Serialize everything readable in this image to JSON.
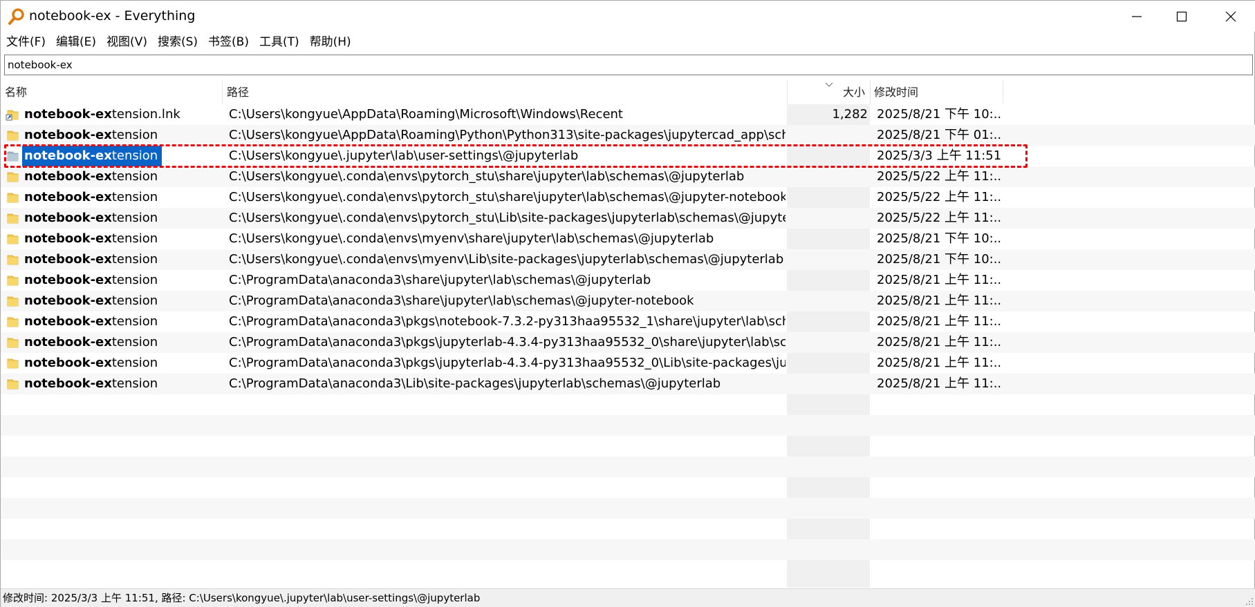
{
  "window": {
    "title": "notebook-ex - Everything",
    "minimize_icon": "minimize-icon",
    "maximize_icon": "maximize-icon",
    "close_icon": "close-icon"
  },
  "menu": [
    "文件(F)",
    "编辑(E)",
    "视图(V)",
    "搜索(S)",
    "书签(B)",
    "工具(T)",
    "帮助(H)"
  ],
  "search": {
    "value": "notebook-ex"
  },
  "columns": {
    "name": "名称",
    "path": "路径",
    "size": "大小",
    "modified": "修改时间"
  },
  "rows": [
    {
      "match": "notebook-ex",
      "rest": "tension.lnk",
      "path": "C:\\Users\\kongyue\\AppData\\Roaming\\Microsoft\\Windows\\Recent",
      "size": "1,282",
      "modified": "2025/8/21 下午 10:...",
      "icon": "shortcut-icon"
    },
    {
      "match": "notebook-ex",
      "rest": "tension",
      "path": "C:\\Users\\kongyue\\AppData\\Roaming\\Python\\Python313\\site-packages\\jupytercad_app\\sch...",
      "size": "",
      "modified": "2025/8/21 下午 01:...",
      "icon": "folder-icon"
    },
    {
      "match": "notebook-ex",
      "rest": "tension",
      "path": "C:\\Users\\kongyue\\.jupyter\\lab\\user-settings\\@jupyterlab",
      "size": "",
      "modified": "2025/3/3 上午 11:51",
      "icon": "folder-icon",
      "selected": true
    },
    {
      "match": "notebook-ex",
      "rest": "tension",
      "path": "C:\\Users\\kongyue\\.conda\\envs\\pytorch_stu\\share\\jupyter\\lab\\schemas\\@jupyterlab",
      "size": "",
      "modified": "2025/5/22 上午 11:...",
      "icon": "folder-icon"
    },
    {
      "match": "notebook-ex",
      "rest": "tension",
      "path": "C:\\Users\\kongyue\\.conda\\envs\\pytorch_stu\\share\\jupyter\\lab\\schemas\\@jupyter-notebook",
      "size": "",
      "modified": "2025/5/22 上午 11:...",
      "icon": "folder-icon"
    },
    {
      "match": "notebook-ex",
      "rest": "tension",
      "path": "C:\\Users\\kongyue\\.conda\\envs\\pytorch_stu\\Lib\\site-packages\\jupyterlab\\schemas\\@jupyter...",
      "size": "",
      "modified": "2025/5/22 上午 11:...",
      "icon": "folder-icon"
    },
    {
      "match": "notebook-ex",
      "rest": "tension",
      "path": "C:\\Users\\kongyue\\.conda\\envs\\myenv\\share\\jupyter\\lab\\schemas\\@jupyterlab",
      "size": "",
      "modified": "2025/8/21 下午 10:...",
      "icon": "folder-icon"
    },
    {
      "match": "notebook-ex",
      "rest": "tension",
      "path": "C:\\Users\\kongyue\\.conda\\envs\\myenv\\Lib\\site-packages\\jupyterlab\\schemas\\@jupyterlab",
      "size": "",
      "modified": "2025/8/21 下午 10:...",
      "icon": "folder-icon"
    },
    {
      "match": "notebook-ex",
      "rest": "tension",
      "path": "C:\\ProgramData\\anaconda3\\share\\jupyter\\lab\\schemas\\@jupyterlab",
      "size": "",
      "modified": "2025/8/21 上午 11:...",
      "icon": "folder-icon"
    },
    {
      "match": "notebook-ex",
      "rest": "tension",
      "path": "C:\\ProgramData\\anaconda3\\share\\jupyter\\lab\\schemas\\@jupyter-notebook",
      "size": "",
      "modified": "2025/8/21 上午 11:...",
      "icon": "folder-icon"
    },
    {
      "match": "notebook-ex",
      "rest": "tension",
      "path": "C:\\ProgramData\\anaconda3\\pkgs\\notebook-7.3.2-py313haa95532_1\\share\\jupyter\\lab\\sch...",
      "size": "",
      "modified": "2025/8/21 上午 11:...",
      "icon": "folder-icon"
    },
    {
      "match": "notebook-ex",
      "rest": "tension",
      "path": "C:\\ProgramData\\anaconda3\\pkgs\\jupyterlab-4.3.4-py313haa95532_0\\share\\jupyter\\lab\\sc...",
      "size": "",
      "modified": "2025/8/21 上午 11:...",
      "icon": "folder-icon"
    },
    {
      "match": "notebook-ex",
      "rest": "tension",
      "path": "C:\\ProgramData\\anaconda3\\pkgs\\jupyterlab-4.3.4-py313haa95532_0\\Lib\\site-packages\\ju...",
      "size": "",
      "modified": "2025/8/21 上午 11:...",
      "icon": "folder-icon"
    },
    {
      "match": "notebook-ex",
      "rest": "tension",
      "path": "C:\\ProgramData\\anaconda3\\Lib\\site-packages\\jupyterlab\\schemas\\@jupyterlab",
      "size": "",
      "modified": "2025/8/21 上午 11:...",
      "icon": "folder-icon"
    }
  ],
  "status": {
    "text": "修改时间: 2025/3/3 上午 11:51, 路径: C:\\Users\\kongyue\\.jupyter\\lab\\user-settings\\@jupyterlab"
  },
  "colors": {
    "accent": "#0a64c8",
    "folder": "#f2c94c",
    "highlight": "#e8000b"
  }
}
